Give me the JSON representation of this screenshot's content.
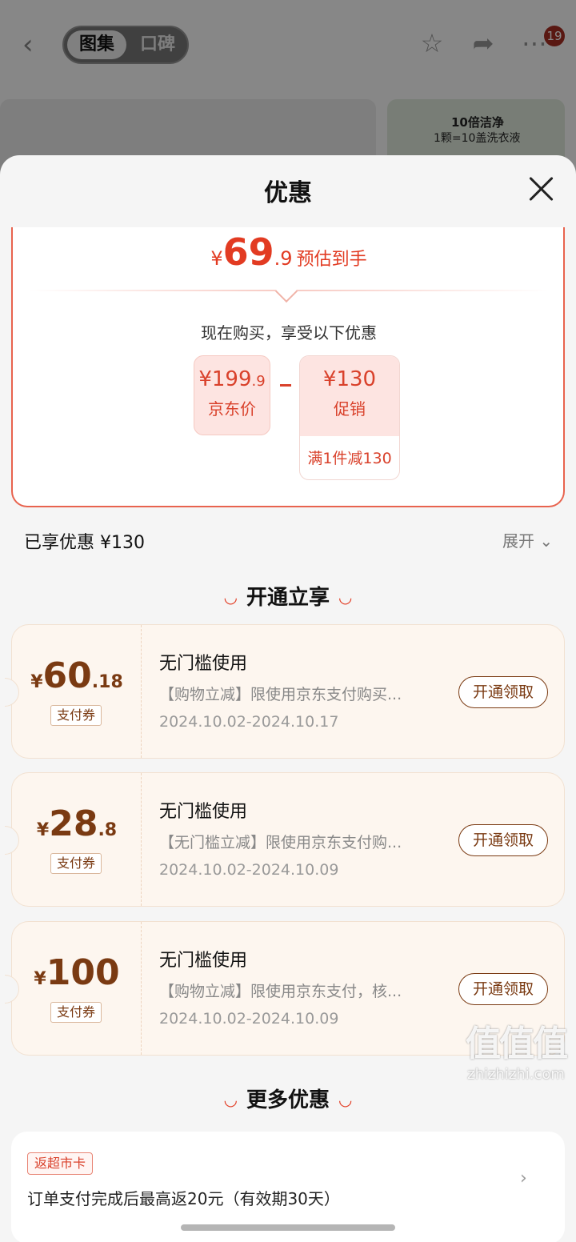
{
  "topbar": {
    "tabs": [
      "图集",
      "口碑"
    ],
    "active_tab": 0,
    "badge": "19",
    "icons": [
      "back-icon",
      "star-icon",
      "share-icon",
      "more-icon"
    ]
  },
  "background": {
    "banner_line1": "10倍洁净",
    "banner_line2": "1颗=10盖洗衣液"
  },
  "sheet": {
    "title": "优惠",
    "estimate": {
      "yen": "¥",
      "int": "69",
      "dec": ".9",
      "label": "预估到手"
    },
    "now_text": "现在购买，享受以下优惠",
    "jd_price": {
      "yen": "¥",
      "int": "199",
      "dec": ".9",
      "caption": "京东价"
    },
    "promo": {
      "yen": "¥",
      "value": "130",
      "caption": "促销",
      "rule": "满1件减130"
    },
    "enjoyed": "已享优惠 ¥130",
    "expand": "展开"
  },
  "open_section": {
    "title": "开通立享"
  },
  "coupons": [
    {
      "yen": "¥",
      "int": "60",
      "dec": ".18",
      "tag": "支付券",
      "title": "无门槛使用",
      "desc": "【购物立减】限使用京东支付购买...",
      "date": "2024.10.02-2024.10.17",
      "button": "开通领取"
    },
    {
      "yen": "¥",
      "int": "28",
      "dec": ".8",
      "tag": "支付券",
      "title": "无门槛使用",
      "desc": "【无门槛立减】限使用京东支付购...",
      "date": "2024.10.02-2024.10.09",
      "button": "开通领取"
    },
    {
      "yen": "¥",
      "int": "100",
      "dec": "",
      "tag": "支付券",
      "title": "无门槛使用",
      "desc": "【购物立减】限使用京东支付，核...",
      "date": "2024.10.02-2024.10.09",
      "button": "开通领取"
    }
  ],
  "more_section": {
    "title": "更多优惠",
    "tag": "返超市卡",
    "text": "订单支付完成后最高返20元（有效期30天）"
  },
  "watermark": {
    "glyphs": "值值值",
    "site": "zhizhizhi.com"
  },
  "colors": {
    "accent": "#e23b22",
    "coupon_brown": "#7a3a12",
    "coupon_bg": "#fdf6ef"
  }
}
